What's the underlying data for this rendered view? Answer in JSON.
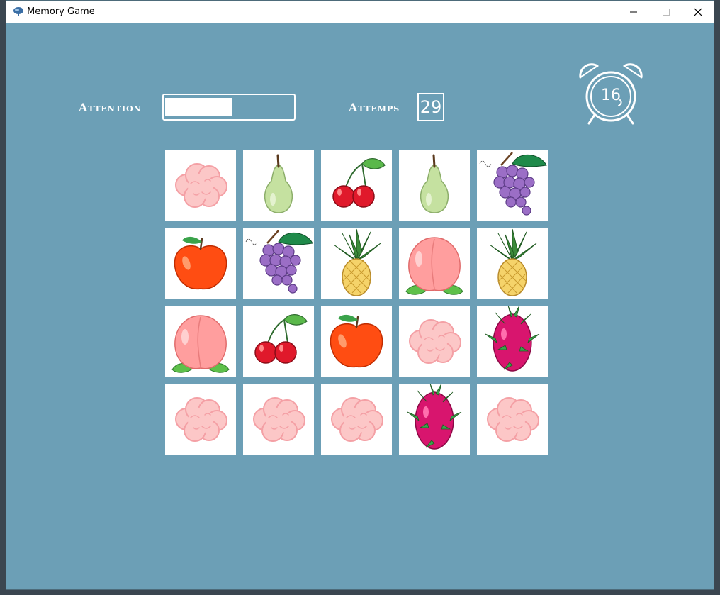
{
  "window": {
    "title": "Memory Game"
  },
  "hud": {
    "attention_label": "Attention",
    "attention_level": 0.53,
    "attempts_label": "Attemps",
    "attempts_value": "29",
    "timer_value": "16"
  },
  "cards": [
    "brain",
    "pear",
    "cherry",
    "pear",
    "grape",
    "apple",
    "grape",
    "pineapple",
    "peach",
    "pineapple",
    "peach",
    "cherry",
    "apple",
    "brain",
    "dragonfruit",
    "brain",
    "brain",
    "brain",
    "dragonfruit",
    "brain"
  ]
}
